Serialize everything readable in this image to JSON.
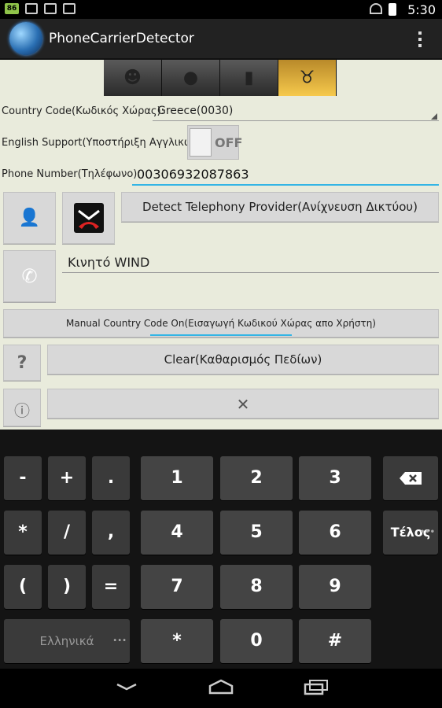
{
  "statusbar": {
    "badge": "86",
    "time": "5:30"
  },
  "app": {
    "title": "PhoneCarrierDetector"
  },
  "thumbs": [
    "worker-icon",
    "apple-icon",
    "bucket-icon",
    "cow-icon"
  ],
  "form": {
    "country_label": "Country Code(Κωδικός Χώρας):",
    "country_value": "Greece(0030)",
    "english_label": "English Support(Υποστήριξη Αγγλικών):",
    "toggle_state": "OFF",
    "phone_label": "Phone Number(Τηλέφωνο):",
    "phone_value": "00306932087863"
  },
  "buttons": {
    "detect": "Detect Telephony Provider(Ανίχνευση Δικτύου)",
    "manual": "Manual Country Code On(Εισαγωγή Κωδικού Χώρας απο Χρήστη)",
    "clear": "Clear(Καθαρισμός Πεδίων)",
    "help": "?",
    "info": "ⓘ",
    "close": "✕"
  },
  "result": {
    "value": "Κινητό WIND"
  },
  "keyboard": {
    "row1": [
      "-",
      "+",
      ".",
      "1",
      "2",
      "3"
    ],
    "row2": [
      "*",
      "/",
      ",",
      "4",
      "5",
      "6"
    ],
    "row3": [
      "(",
      ")",
      "=",
      "7",
      "8",
      "9"
    ],
    "row4": [
      "Ελληνικά",
      "*",
      "0",
      "#"
    ],
    "done": "Τέλος"
  }
}
